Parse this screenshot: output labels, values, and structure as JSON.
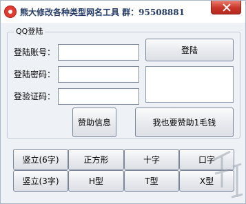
{
  "window": {
    "title": "熊大修改各种类型网名工具 群：95508881"
  },
  "login_group": {
    "title": "QQ登陆",
    "account_label": "登陆账号：",
    "password_label": "登陆密码：",
    "captcha_label": "登验证码：",
    "account_value": "",
    "password_value": "",
    "captcha_value": "",
    "login_button": "登陆",
    "sponsor_info_button": "赞助信息",
    "sponsor_me_button": "我也要赞助1毛钱"
  },
  "style_buttons": {
    "vertical_6": "竖立(6字)",
    "square": "正方形",
    "cross": "十字",
    "mouth": "口字",
    "vertical_3": "竖立(3字)",
    "h_shape": "H型",
    "t_shape": "T型",
    "x_shape": "X型"
  },
  "colors": {
    "title_text": "#243b66",
    "window_bg": "#eef1f6",
    "close_button": "#c9352a"
  }
}
